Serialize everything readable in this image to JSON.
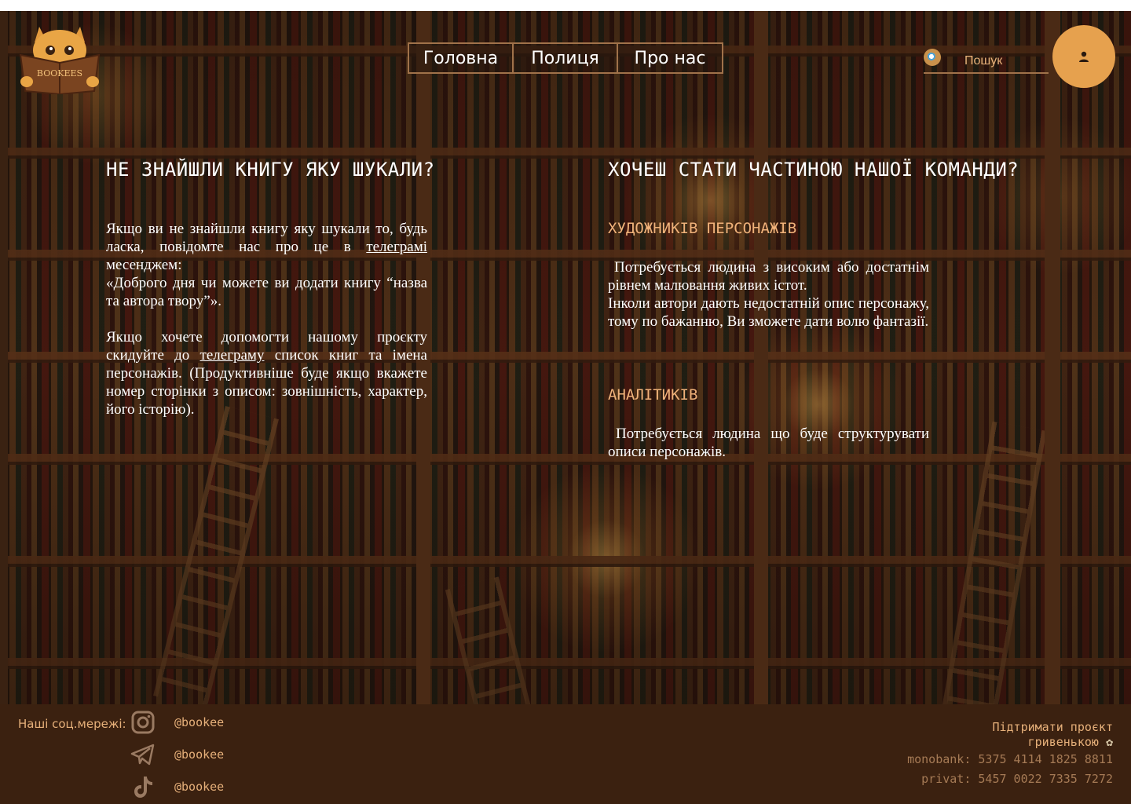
{
  "brand": {
    "name": "BOOKEES"
  },
  "nav": {
    "home": "Головна",
    "shelf": "Полиця",
    "about": "Про нас"
  },
  "search": {
    "placeholder": "Пошук"
  },
  "left": {
    "title": "НЕ ЗНАЙШЛИ КНИГУ ЯКУ ШУКАЛИ?",
    "p1_before": "Якщо ви не знайшли книгу яку шукали то, будь ласка, повідомте нас про це в ",
    "p1_link": "телеграмі",
    "p1_after": " месенджем:",
    "p1_quote": "«Доброго дня чи можете ви додати книгу “назва та автора твору”».",
    "p2_before": "Якщо хочете допомогти нашому проєкту скидуйте до ",
    "p2_link": "телеграму",
    "p2_after": " список книг та імена персонажів. (Продуктивніше буде якщо вкажете номер сторінки з описом: зовнішність, характер, його історію)."
  },
  "right": {
    "title": "ХОЧЕШ СТАТИ ЧАСТИНОЮ НАШОЇ КОМАНДИ?",
    "artists_title": "ХУДОЖНИКІВ ПЕРСОНАЖІВ",
    "artists_text": "Потребується людина з високим або достатнім рівнем малювання живих істот.",
    "artists_text2": "Інколи автори дають недостатній опис персонажу, тому по бажанню, Ви зможете дати волю фантазії.",
    "analysts_title": "АНАЛІТИКІВ",
    "analysts_text": "Потребується людина що буде структурувати описи персонажів."
  },
  "footer": {
    "socials_label": "Наші соц.мережі:",
    "socials": [
      {
        "icon": "instagram-icon",
        "handle": "@bookee"
      },
      {
        "icon": "telegram-icon",
        "handle": "@bookee"
      },
      {
        "icon": "tiktok-icon",
        "handle": "@bookee"
      }
    ],
    "donate_line1": "Підтримати проєкт",
    "donate_line2": "гривенькою",
    "monobank": "monobank: 5375 4114 1825 8811",
    "privat": "privat: 5457 0022 7335 7272"
  },
  "colors": {
    "accent": "#e6a14e",
    "footer_bg": "#3b2110",
    "footer_text": "#e6b07a",
    "subheading": "#f0b27a"
  }
}
